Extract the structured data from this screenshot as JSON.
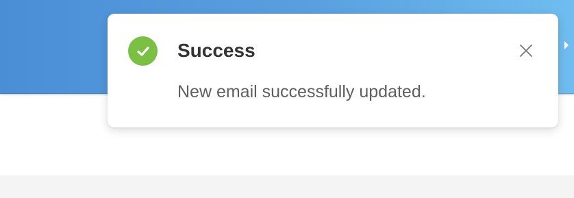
{
  "notification": {
    "type": "success",
    "title": "Success",
    "message": "New email successfully updated.",
    "icon": "check-circle-icon",
    "close_icon": "close-icon"
  },
  "colors": {
    "success_accent": "#7ac143",
    "header_gradient_start": "#4a8fd6",
    "header_gradient_end": "#6fbdf0",
    "title_text": "#333333",
    "message_text": "#5f5f5f",
    "footer_background": "#f4f4f4"
  }
}
